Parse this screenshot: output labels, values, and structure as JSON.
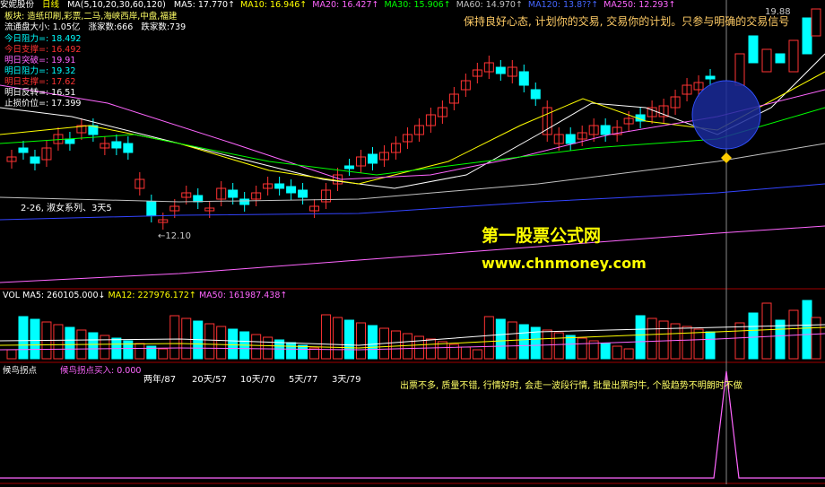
{
  "header": {
    "stock_name": "安妮股份",
    "period": "日线",
    "ma_params": "MA(5,10,20,30,60,120)",
    "ma_items": [
      {
        "label": "MA5:",
        "value": "17.770",
        "color": "#ffffff"
      },
      {
        "label": "MA10:",
        "value": "16.946",
        "color": "#ffff00"
      },
      {
        "label": "MA20:",
        "value": "16.427",
        "color": "#ff66ff"
      },
      {
        "label": "MA30:",
        "value": "15.906",
        "color": "#00ff00"
      },
      {
        "label": "MA60:",
        "value": "14.970",
        "color": "#c0c0c0"
      },
      {
        "label": "MA120:",
        "value": "13.8??",
        "color": "#4466ff"
      },
      {
        "label": "MA250:",
        "value": "12.293",
        "color": "#ff66ff"
      }
    ]
  },
  "info_panel": {
    "sector": "板块: 造纸印刷,彩票,二马,海峡西岸,中盘,福建",
    "float_cap": "流通盘大小: 1.05亿",
    "up_count": "涨家数:666",
    "down_count": "跌家数:739",
    "today_resist": "今日阻力=: 18.492",
    "today_support": "今日支撑=: 16.492",
    "tomorrow_break": "明日突破=: 19.91",
    "tomorrow_resist": "明日阻力=: 19.32",
    "tomorrow_support": "明日支撑=: 17.62",
    "tomorrow_reverse": "明日反转=: 16.51",
    "stop_loss": "止损价位=: 17.399"
  },
  "annotations": {
    "series_label": "2-26, 淑女系列、3天5",
    "low_label": "12.10",
    "high_label": "19.88"
  },
  "watermark": {
    "title": "第一股票公式网",
    "url": "www.chnmoney.com"
  },
  "slogan": "保持良好心态, 计划你的交易, 交易你的计划。只参与明确的交易信号",
  "volume_header": {
    "vol": "VOL",
    "ma5": "MA5: 260105.000↓",
    "ma12": "MA12: 227976.172↑",
    "ma50": "MA50: 161987.438↑"
  },
  "indicator": {
    "name": "候鸟拐点",
    "buy_label": "候鸟拐点买入: 0.000",
    "tabs": [
      "两年/87",
      "20天/57",
      "10天/70",
      "5天/77",
      "3天/79"
    ],
    "note": "出票不多, 质量不错, 行情好时, 会走一波段行情, 批量出票时牛, 个股趋势不明朗时不做"
  },
  "colors": {
    "bg": "#000000",
    "up": "#ff3333",
    "down": "#00ffff",
    "grid": "#800000",
    "signal": "#ff66ff"
  }
}
